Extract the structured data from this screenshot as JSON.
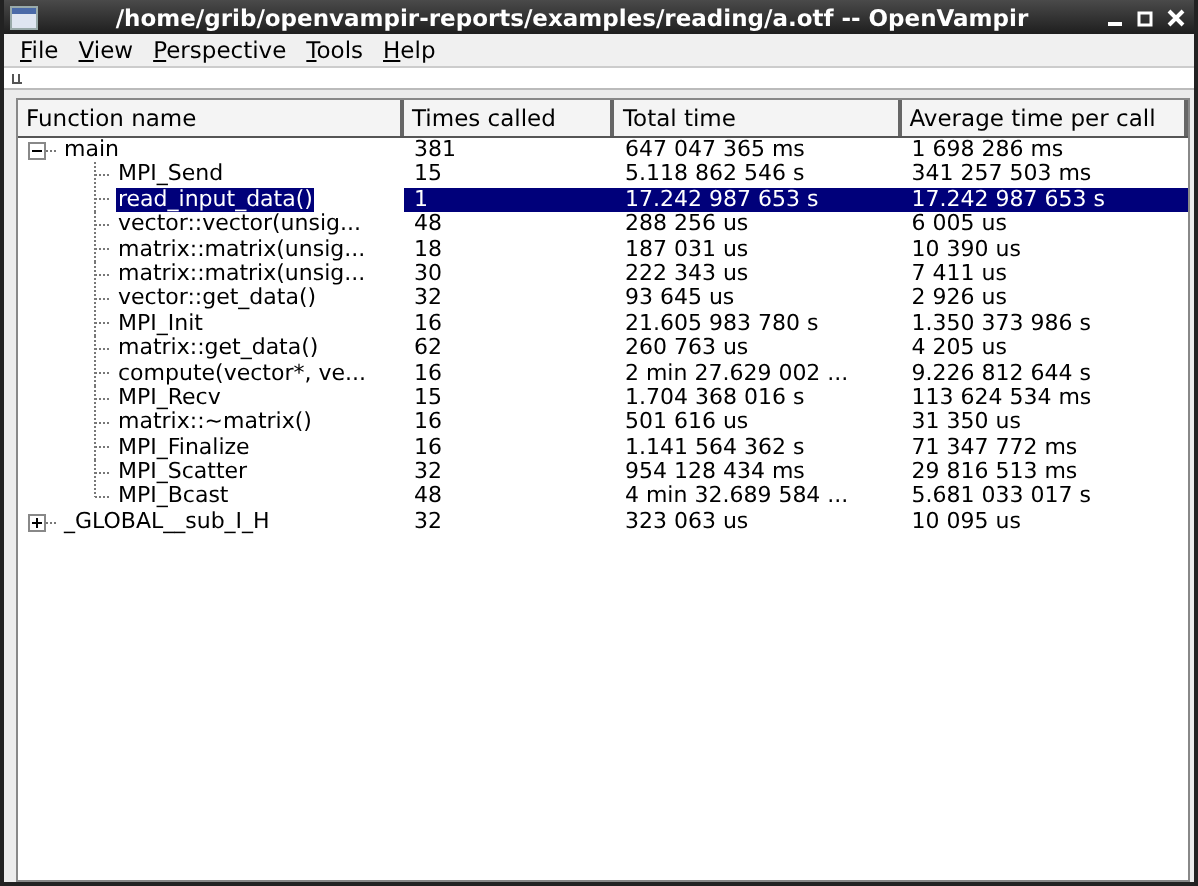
{
  "window": {
    "title": "/home/grib/openvampir-reports/examples/reading/a.otf -- OpenVampir"
  },
  "menu": [
    "File",
    "View",
    "Perspective",
    "Tools",
    "Help"
  ],
  "table": {
    "columns": [
      "Function name",
      "Times called",
      "Total time",
      "Average time per call"
    ],
    "rows": [
      {
        "name": "main",
        "calls": "381",
        "total": "647 047 365 ms",
        "average": "1 698 286 ms",
        "selected": false,
        "expanded": true,
        "children": [
          {
            "name": "MPI_Send",
            "calls": "15",
            "total": "5.118 862 546 s",
            "average": "341 257 503 ms",
            "selected": false
          },
          {
            "name": "read_input_data()",
            "calls": "1",
            "total": "17.242 987 653 s",
            "average": "17.242 987 653 s",
            "selected": true
          },
          {
            "name": "vector::vector(unsig...",
            "calls": "48",
            "total": "288 256 us",
            "average": "6 005 us",
            "selected": false
          },
          {
            "name": "matrix::matrix(unsig...",
            "calls": "18",
            "total": "187 031 us",
            "average": "10 390 us",
            "selected": false
          },
          {
            "name": "matrix::matrix(unsig...",
            "calls": "30",
            "total": "222 343 us",
            "average": "7 411 us",
            "selected": false
          },
          {
            "name": "vector::get_data()",
            "calls": "32",
            "total": "93 645 us",
            "average": "2 926 us",
            "selected": false
          },
          {
            "name": "MPI_Init",
            "calls": "16",
            "total": "21.605 983 780 s",
            "average": "1.350 373 986 s",
            "selected": false
          },
          {
            "name": "matrix::get_data()",
            "calls": "62",
            "total": "260 763 us",
            "average": "4 205 us",
            "selected": false
          },
          {
            "name": "compute(vector*, ve...",
            "calls": "16",
            "total": "2 min 27.629 002 ...",
            "average": "9.226 812 644 s",
            "selected": false
          },
          {
            "name": "MPI_Recv",
            "calls": "15",
            "total": "1.704 368 016 s",
            "average": "113 624 534 ms",
            "selected": false
          },
          {
            "name": "matrix::~matrix()",
            "calls": "16",
            "total": "501 616 us",
            "average": "31 350 us",
            "selected": false
          },
          {
            "name": "MPI_Finalize",
            "calls": "16",
            "total": "1.141 564 362 s",
            "average": "71 347 772 ms",
            "selected": false
          },
          {
            "name": "MPI_Scatter",
            "calls": "32",
            "total": "954 128 434 ms",
            "average": "29 816 513 ms",
            "selected": false
          },
          {
            "name": "MPI_Bcast",
            "calls": "48",
            "total": "4 min 32.689 584 ...",
            "average": "5.681 033 017 s",
            "selected": false
          }
        ]
      },
      {
        "name": "_GLOBAL__sub_I_H",
        "calls": "32",
        "total": "323 063 us",
        "average": "10 095 us",
        "selected": false,
        "expanded": false
      }
    ]
  }
}
